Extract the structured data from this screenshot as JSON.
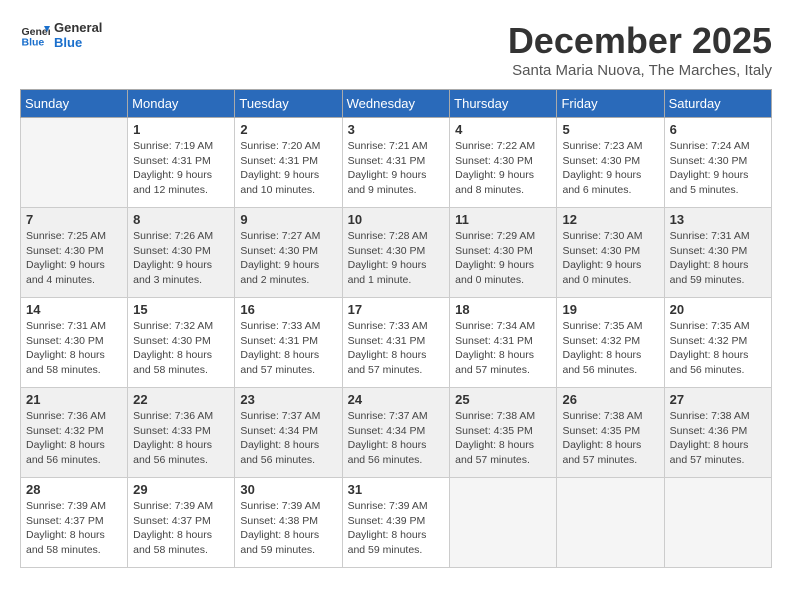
{
  "logo": {
    "text_general": "General",
    "text_blue": "Blue"
  },
  "title": {
    "month": "December 2025",
    "location": "Santa Maria Nuova, The Marches, Italy"
  },
  "headers": [
    "Sunday",
    "Monday",
    "Tuesday",
    "Wednesday",
    "Thursday",
    "Friday",
    "Saturday"
  ],
  "weeks": [
    {
      "shaded": false,
      "days": [
        {
          "num": "",
          "info": ""
        },
        {
          "num": "1",
          "info": "Sunrise: 7:19 AM\nSunset: 4:31 PM\nDaylight: 9 hours\nand 12 minutes."
        },
        {
          "num": "2",
          "info": "Sunrise: 7:20 AM\nSunset: 4:31 PM\nDaylight: 9 hours\nand 10 minutes."
        },
        {
          "num": "3",
          "info": "Sunrise: 7:21 AM\nSunset: 4:31 PM\nDaylight: 9 hours\nand 9 minutes."
        },
        {
          "num": "4",
          "info": "Sunrise: 7:22 AM\nSunset: 4:30 PM\nDaylight: 9 hours\nand 8 minutes."
        },
        {
          "num": "5",
          "info": "Sunrise: 7:23 AM\nSunset: 4:30 PM\nDaylight: 9 hours\nand 6 minutes."
        },
        {
          "num": "6",
          "info": "Sunrise: 7:24 AM\nSunset: 4:30 PM\nDaylight: 9 hours\nand 5 minutes."
        }
      ]
    },
    {
      "shaded": true,
      "days": [
        {
          "num": "7",
          "info": "Sunrise: 7:25 AM\nSunset: 4:30 PM\nDaylight: 9 hours\nand 4 minutes."
        },
        {
          "num": "8",
          "info": "Sunrise: 7:26 AM\nSunset: 4:30 PM\nDaylight: 9 hours\nand 3 minutes."
        },
        {
          "num": "9",
          "info": "Sunrise: 7:27 AM\nSunset: 4:30 PM\nDaylight: 9 hours\nand 2 minutes."
        },
        {
          "num": "10",
          "info": "Sunrise: 7:28 AM\nSunset: 4:30 PM\nDaylight: 9 hours\nand 1 minute."
        },
        {
          "num": "11",
          "info": "Sunrise: 7:29 AM\nSunset: 4:30 PM\nDaylight: 9 hours\nand 0 minutes."
        },
        {
          "num": "12",
          "info": "Sunrise: 7:30 AM\nSunset: 4:30 PM\nDaylight: 9 hours\nand 0 minutes."
        },
        {
          "num": "13",
          "info": "Sunrise: 7:31 AM\nSunset: 4:30 PM\nDaylight: 8 hours\nand 59 minutes."
        }
      ]
    },
    {
      "shaded": false,
      "days": [
        {
          "num": "14",
          "info": "Sunrise: 7:31 AM\nSunset: 4:30 PM\nDaylight: 8 hours\nand 58 minutes."
        },
        {
          "num": "15",
          "info": "Sunrise: 7:32 AM\nSunset: 4:30 PM\nDaylight: 8 hours\nand 58 minutes."
        },
        {
          "num": "16",
          "info": "Sunrise: 7:33 AM\nSunset: 4:31 PM\nDaylight: 8 hours\nand 57 minutes."
        },
        {
          "num": "17",
          "info": "Sunrise: 7:33 AM\nSunset: 4:31 PM\nDaylight: 8 hours\nand 57 minutes."
        },
        {
          "num": "18",
          "info": "Sunrise: 7:34 AM\nSunset: 4:31 PM\nDaylight: 8 hours\nand 57 minutes."
        },
        {
          "num": "19",
          "info": "Sunrise: 7:35 AM\nSunset: 4:32 PM\nDaylight: 8 hours\nand 56 minutes."
        },
        {
          "num": "20",
          "info": "Sunrise: 7:35 AM\nSunset: 4:32 PM\nDaylight: 8 hours\nand 56 minutes."
        }
      ]
    },
    {
      "shaded": true,
      "days": [
        {
          "num": "21",
          "info": "Sunrise: 7:36 AM\nSunset: 4:32 PM\nDaylight: 8 hours\nand 56 minutes."
        },
        {
          "num": "22",
          "info": "Sunrise: 7:36 AM\nSunset: 4:33 PM\nDaylight: 8 hours\nand 56 minutes."
        },
        {
          "num": "23",
          "info": "Sunrise: 7:37 AM\nSunset: 4:34 PM\nDaylight: 8 hours\nand 56 minutes."
        },
        {
          "num": "24",
          "info": "Sunrise: 7:37 AM\nSunset: 4:34 PM\nDaylight: 8 hours\nand 56 minutes."
        },
        {
          "num": "25",
          "info": "Sunrise: 7:38 AM\nSunset: 4:35 PM\nDaylight: 8 hours\nand 57 minutes."
        },
        {
          "num": "26",
          "info": "Sunrise: 7:38 AM\nSunset: 4:35 PM\nDaylight: 8 hours\nand 57 minutes."
        },
        {
          "num": "27",
          "info": "Sunrise: 7:38 AM\nSunset: 4:36 PM\nDaylight: 8 hours\nand 57 minutes."
        }
      ]
    },
    {
      "shaded": false,
      "days": [
        {
          "num": "28",
          "info": "Sunrise: 7:39 AM\nSunset: 4:37 PM\nDaylight: 8 hours\nand 58 minutes."
        },
        {
          "num": "29",
          "info": "Sunrise: 7:39 AM\nSunset: 4:37 PM\nDaylight: 8 hours\nand 58 minutes."
        },
        {
          "num": "30",
          "info": "Sunrise: 7:39 AM\nSunset: 4:38 PM\nDaylight: 8 hours\nand 59 minutes."
        },
        {
          "num": "31",
          "info": "Sunrise: 7:39 AM\nSunset: 4:39 PM\nDaylight: 8 hours\nand 59 minutes."
        },
        {
          "num": "",
          "info": ""
        },
        {
          "num": "",
          "info": ""
        },
        {
          "num": "",
          "info": ""
        }
      ]
    }
  ]
}
